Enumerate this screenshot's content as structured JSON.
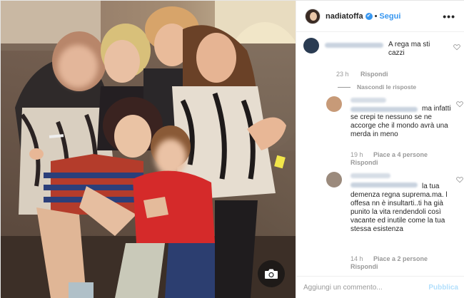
{
  "post": {
    "username": "nadiatoffa",
    "follow_label": "Segui",
    "separator": "•",
    "more_label": "•••",
    "camera_icon": "camera-icon",
    "verified_icon": "verified-badge-icon"
  },
  "comments": [
    {
      "text": "A rega ma sti cazzi",
      "time": "23 h",
      "reply_label": "Rispondi",
      "hide_replies_label": "Nascondi le risposte"
    },
    {
      "text": "ma infatti se crepi te nessuno se ne accorge che il mondo avrà una merda in meno",
      "time": "19 h",
      "likes": "Piace a 4 persone",
      "reply_label": "Rispondi"
    },
    {
      "text": "la tua demenza regna suprema.ma. l offesa nn è insultarti..ti ha già punito la vita rendendoli così vacante ed inutile come la tua stessa esistenza",
      "time": "14 h",
      "likes": "Piace a 2 persone",
      "reply_label": "Rispondi"
    }
  ],
  "composer": {
    "placeholder": "Aggiungi un commento...",
    "publish_label": "Pubblica"
  },
  "colors": {
    "accent": "#3897f0",
    "publish_disabled": "#b2dffc",
    "meta": "#999999"
  }
}
